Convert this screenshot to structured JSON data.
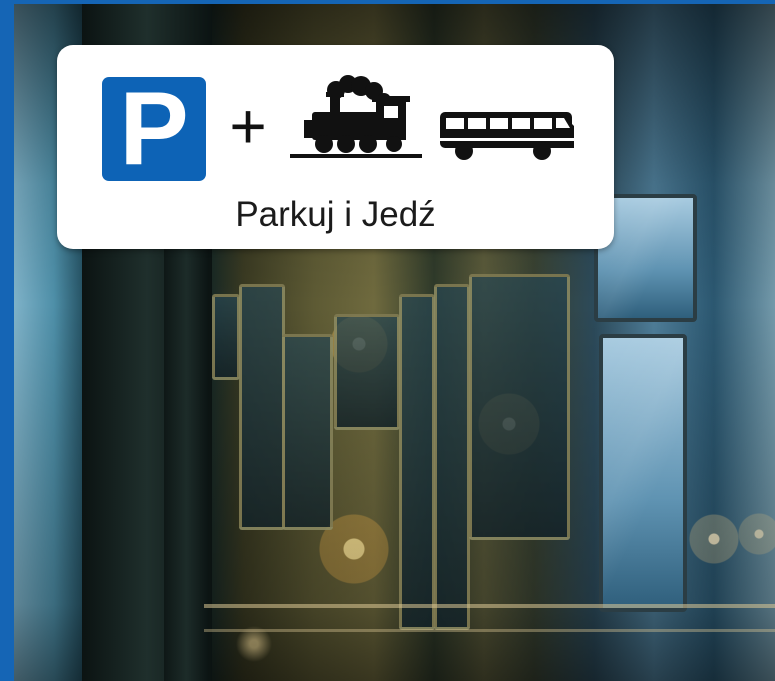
{
  "logo": {
    "parking_letter": "P",
    "plus_sign": "+",
    "caption": "Parkuj i Jedź",
    "icons": [
      "parking-sign-icon",
      "steam-train-icon",
      "bus-icon"
    ]
  },
  "colors": {
    "parking_blue": "#0d63b6",
    "frame_blue": "#1565b5",
    "card_bg": "#ffffff",
    "glyph_black": "#111111"
  }
}
